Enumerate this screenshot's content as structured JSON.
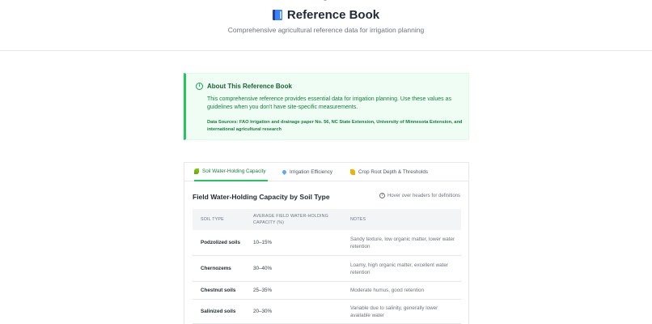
{
  "header": {
    "title": "Reference Book",
    "subtitle": "Comprehensive agricultural reference data for irrigation planning"
  },
  "about": {
    "title": "About This Reference Book",
    "body": "This comprehensive reference provides essential data for irrigation planning. Use these values as guidelines when you don't have site-specific measurements.",
    "sources": "Data Sources: FAO Irrigation and drainage paper No. 56, NC State Extension, University of Minnesota Extension, and international agricultural research"
  },
  "tabs": [
    {
      "label": "Soil Water-Holding Capacity",
      "active": true
    },
    {
      "label": "Irrigation Efficiency",
      "active": false
    },
    {
      "label": "Crop Root Depth & Thresholds",
      "active": false
    }
  ],
  "section": {
    "title": "Field Water-Holding Capacity by Soil Type",
    "hint": "Hover over headers for definitions"
  },
  "table": {
    "headers": [
      "Soil Type",
      "Average Field Water-Holding Capacity (%)",
      "Notes"
    ],
    "rows": [
      {
        "soil": "Podzolized soils",
        "capacity": "10–15%",
        "notes": "Sandy texture, low organic matter, lower water retention"
      },
      {
        "soil": "Chernozems",
        "capacity": "30–40%",
        "notes": "Loamy, high organic matter, excellent water retention"
      },
      {
        "soil": "Chestnut soils",
        "capacity": "25–35%",
        "notes": "Moderate humus, good retention"
      },
      {
        "soil": "Salinized soils",
        "capacity": "20–30%",
        "notes": "Variable due to salinity, generally lower available water"
      }
    ]
  },
  "colors": {
    "accent": "#22c55e",
    "accent_bg": "#f0fdf4"
  }
}
